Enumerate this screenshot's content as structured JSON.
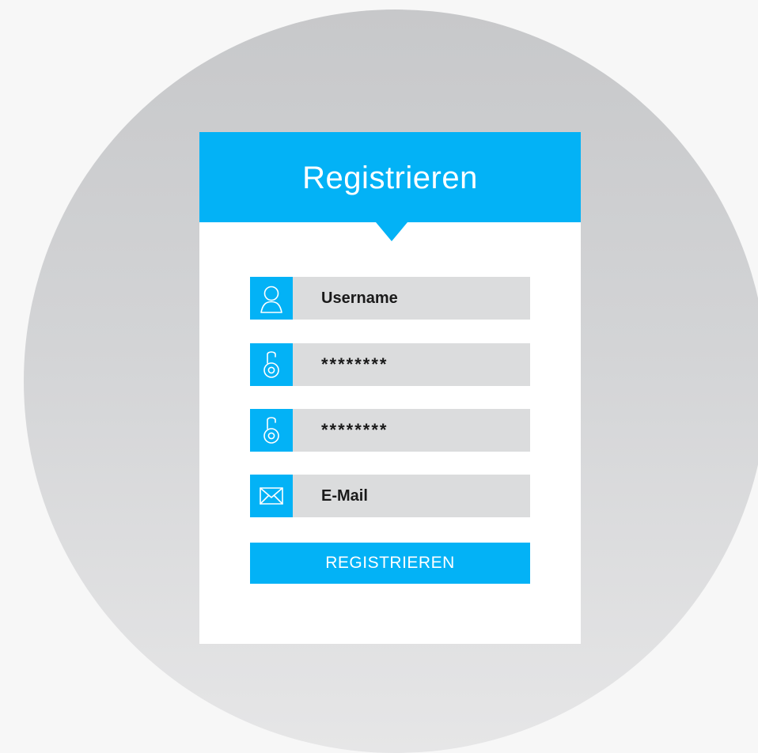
{
  "form": {
    "title": "Registrieren",
    "fields": [
      {
        "icon": "user-icon",
        "value": "",
        "placeholder": "Username",
        "type": "text"
      },
      {
        "icon": "lock-icon",
        "value": "********",
        "placeholder": "",
        "type": "text"
      },
      {
        "icon": "lock-icon",
        "value": "********",
        "placeholder": "",
        "type": "text"
      },
      {
        "icon": "mail-icon",
        "value": "",
        "placeholder": "E-Mail",
        "type": "text"
      }
    ],
    "submit_label": "REGISTRIEREN"
  },
  "colors": {
    "accent": "#03b2f6",
    "field_background": "#dbdcdd",
    "card_background": "#ffffff",
    "page_background": "#f7f7f7",
    "circle_background": "#cfd0d2",
    "text": "#1a1a1a"
  }
}
